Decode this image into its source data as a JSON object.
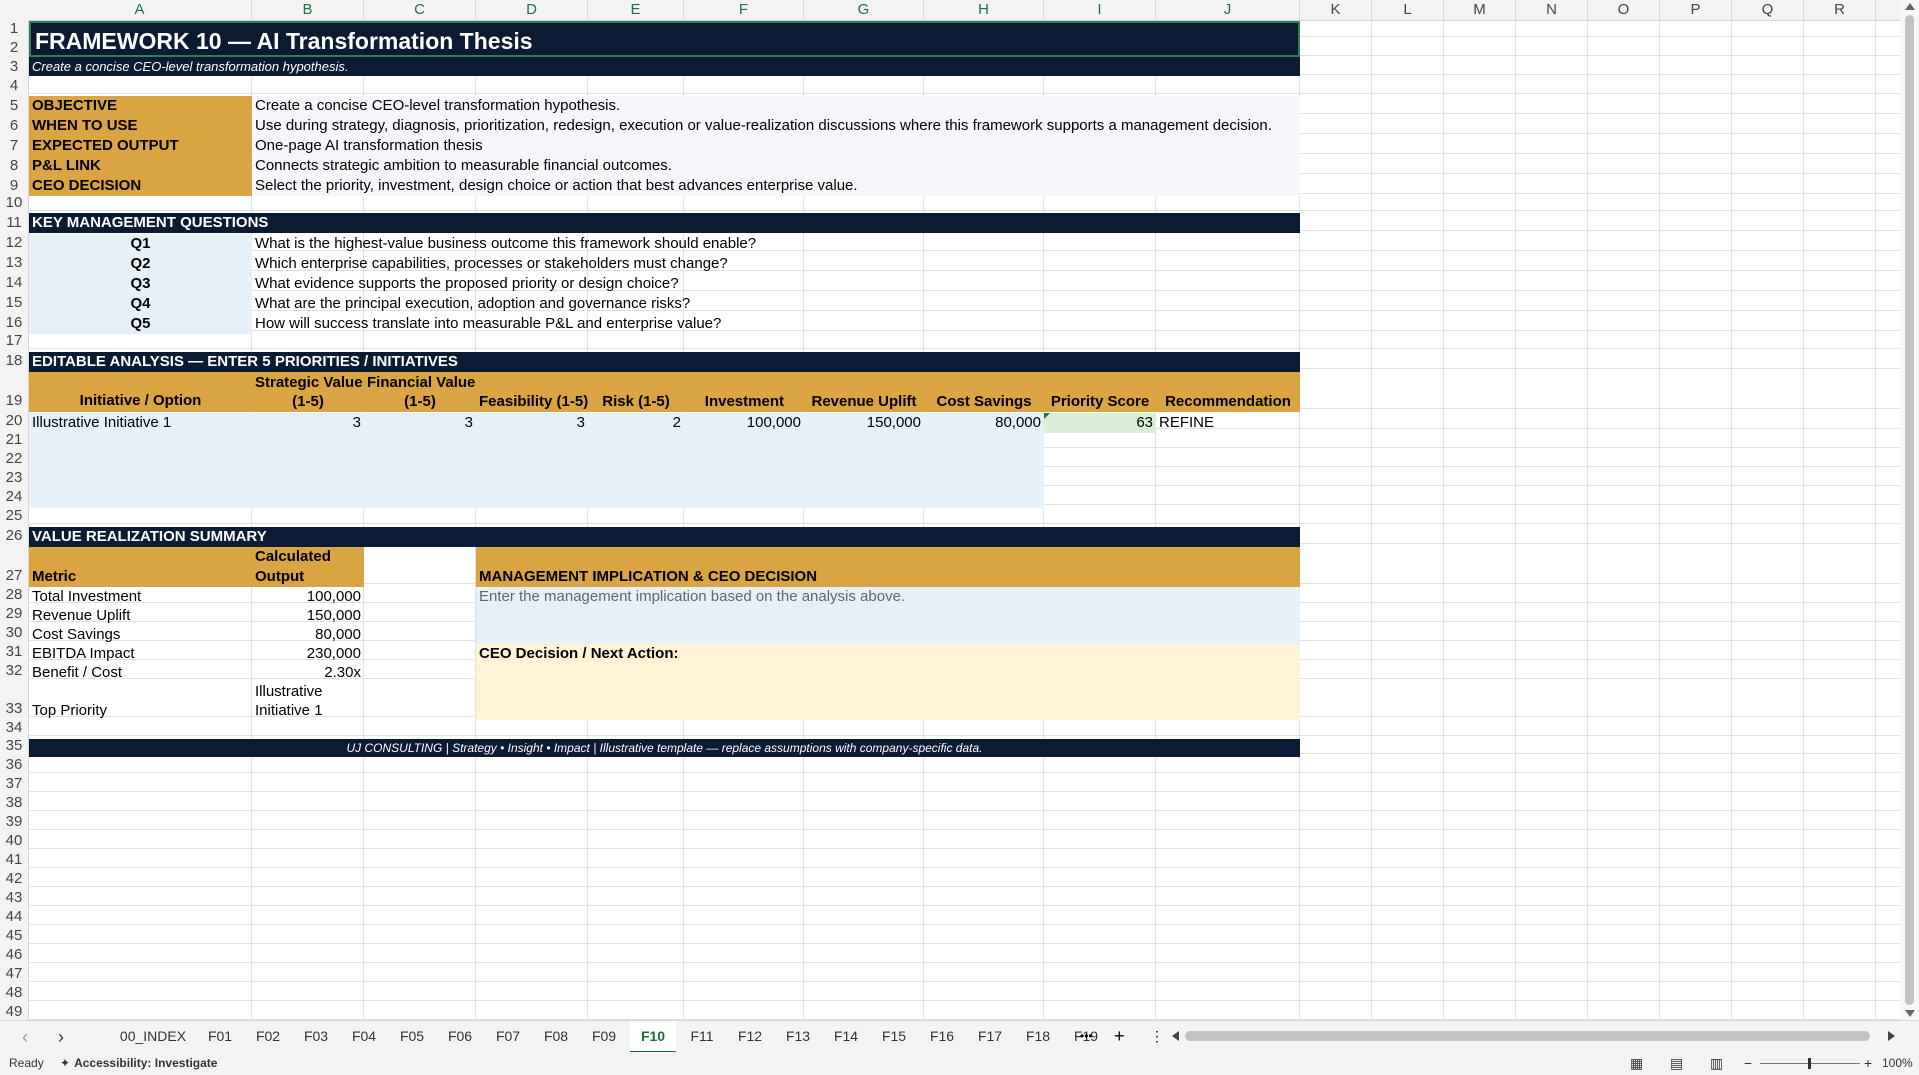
{
  "columns": [
    "A",
    "B",
    "C",
    "D",
    "E",
    "F",
    "G",
    "H",
    "I",
    "J",
    "K",
    "L",
    "M",
    "N",
    "O",
    "P",
    "Q",
    "R"
  ],
  "rows": [
    "1",
    "2",
    "3",
    "4",
    "5",
    "6",
    "7",
    "8",
    "9",
    "10",
    "11",
    "12",
    "13",
    "14",
    "15",
    "16",
    "17",
    "18",
    "19",
    "20",
    "21",
    "22",
    "23",
    "24",
    "25",
    "26",
    "27",
    "28",
    "29",
    "30",
    "31",
    "32",
    "33",
    "34",
    "35",
    "36",
    "37",
    "38",
    "39",
    "40",
    "41",
    "42",
    "43",
    "44",
    "45",
    "46",
    "47",
    "48",
    "49"
  ],
  "sheet": {
    "title": "FRAMEWORK 10 — AI Transformation Thesis",
    "subtitle": "Create a concise CEO-level transformation hypothesis.",
    "info": [
      {
        "label": "OBJECTIVE",
        "value": "Create a concise CEO-level transformation hypothesis."
      },
      {
        "label": "WHEN TO USE",
        "value": "Use during strategy, diagnosis, prioritization, redesign, execution or value-realization discussions where this framework supports a management decision."
      },
      {
        "label": "EXPECTED OUTPUT",
        "value": "One-page AI transformation thesis"
      },
      {
        "label": "P&L LINK",
        "value": "Connects strategic ambition to measurable financial outcomes."
      },
      {
        "label": "CEO DECISION",
        "value": "Select the priority, investment, design choice or action that best advances enterprise value."
      }
    ],
    "questions_header": "KEY MANAGEMENT QUESTIONS",
    "questions": [
      {
        "id": "Q1",
        "text": "What is the highest-value business outcome this framework should enable?"
      },
      {
        "id": "Q2",
        "text": "Which enterprise capabilities, processes or stakeholders must change?"
      },
      {
        "id": "Q3",
        "text": "What evidence supports the proposed priority or design choice?"
      },
      {
        "id": "Q4",
        "text": "What are the principal execution, adoption and governance risks?"
      },
      {
        "id": "Q5",
        "text": "How will success translate into measurable P&L and enterprise value?"
      }
    ],
    "analysis_header": "EDITABLE ANALYSIS — ENTER 5 PRIORITIES / INITIATIVES",
    "analysis_cols": {
      "a": "Initiative / Option",
      "b1": "Strategic Value",
      "b2": "(1-5)",
      "c1": "Financial Value",
      "c2": "(1-5)",
      "d": "Feasibility (1-5)",
      "e": "Risk (1-5)",
      "f": "Investment",
      "g": "Revenue Uplift",
      "h": "Cost Savings",
      "i": "Priority Score",
      "j": "Recommendation"
    },
    "analysis_row": {
      "a": "Illustrative Initiative 1",
      "b": "3",
      "c": "3",
      "d": "3",
      "e": "2",
      "f": "100,000",
      "g": "150,000",
      "h": "80,000",
      "i": "63",
      "j": "REFINE"
    },
    "value_header": "VALUE REALIZATION SUMMARY",
    "metric_label": "Metric",
    "output_label1": "Calculated",
    "output_label2": "Output",
    "metrics": [
      {
        "name": "Total Investment",
        "value": "100,000"
      },
      {
        "name": "Revenue Uplift",
        "value": "150,000"
      },
      {
        "name": "Cost Savings",
        "value": "80,000"
      },
      {
        "name": "EBITDA Impact",
        "value": "230,000"
      },
      {
        "name": "Benefit / Cost",
        "value": "2.30x"
      }
    ],
    "top_priority_label": "Top Priority",
    "top_priority_value1": "Illustrative",
    "top_priority_value2": "Initiative 1",
    "implication_header": "MANAGEMENT IMPLICATION & CEO DECISION",
    "implication_placeholder": "Enter the management implication based on the analysis above.",
    "ceo_decision_label": "CEO Decision / Next Action:",
    "footer": "UJ CONSULTING | Strategy • Insight • Impact | Illustrative template — replace assumptions with company-specific data."
  },
  "tabs": [
    "00_INDEX",
    "F01",
    "F02",
    "F03",
    "F04",
    "F05",
    "F06",
    "F07",
    "F08",
    "F09",
    "F10",
    "F11",
    "F12",
    "F13",
    "F14",
    "F15",
    "F16",
    "F17",
    "F18",
    "F19"
  ],
  "active_tab": "F10",
  "more_tabs_symbol": "•••",
  "add_sheet_symbol": "+",
  "status": {
    "ready": "Ready",
    "accessibility": "Accessibility: Investigate",
    "zoom": "100%"
  },
  "colors": {
    "navy": "#0b1b33",
    "gold": "#d9a441",
    "light_blue": "#e6f0f8",
    "light_yellow": "#fef3d6",
    "accent_green": "#1e6b3a"
  }
}
